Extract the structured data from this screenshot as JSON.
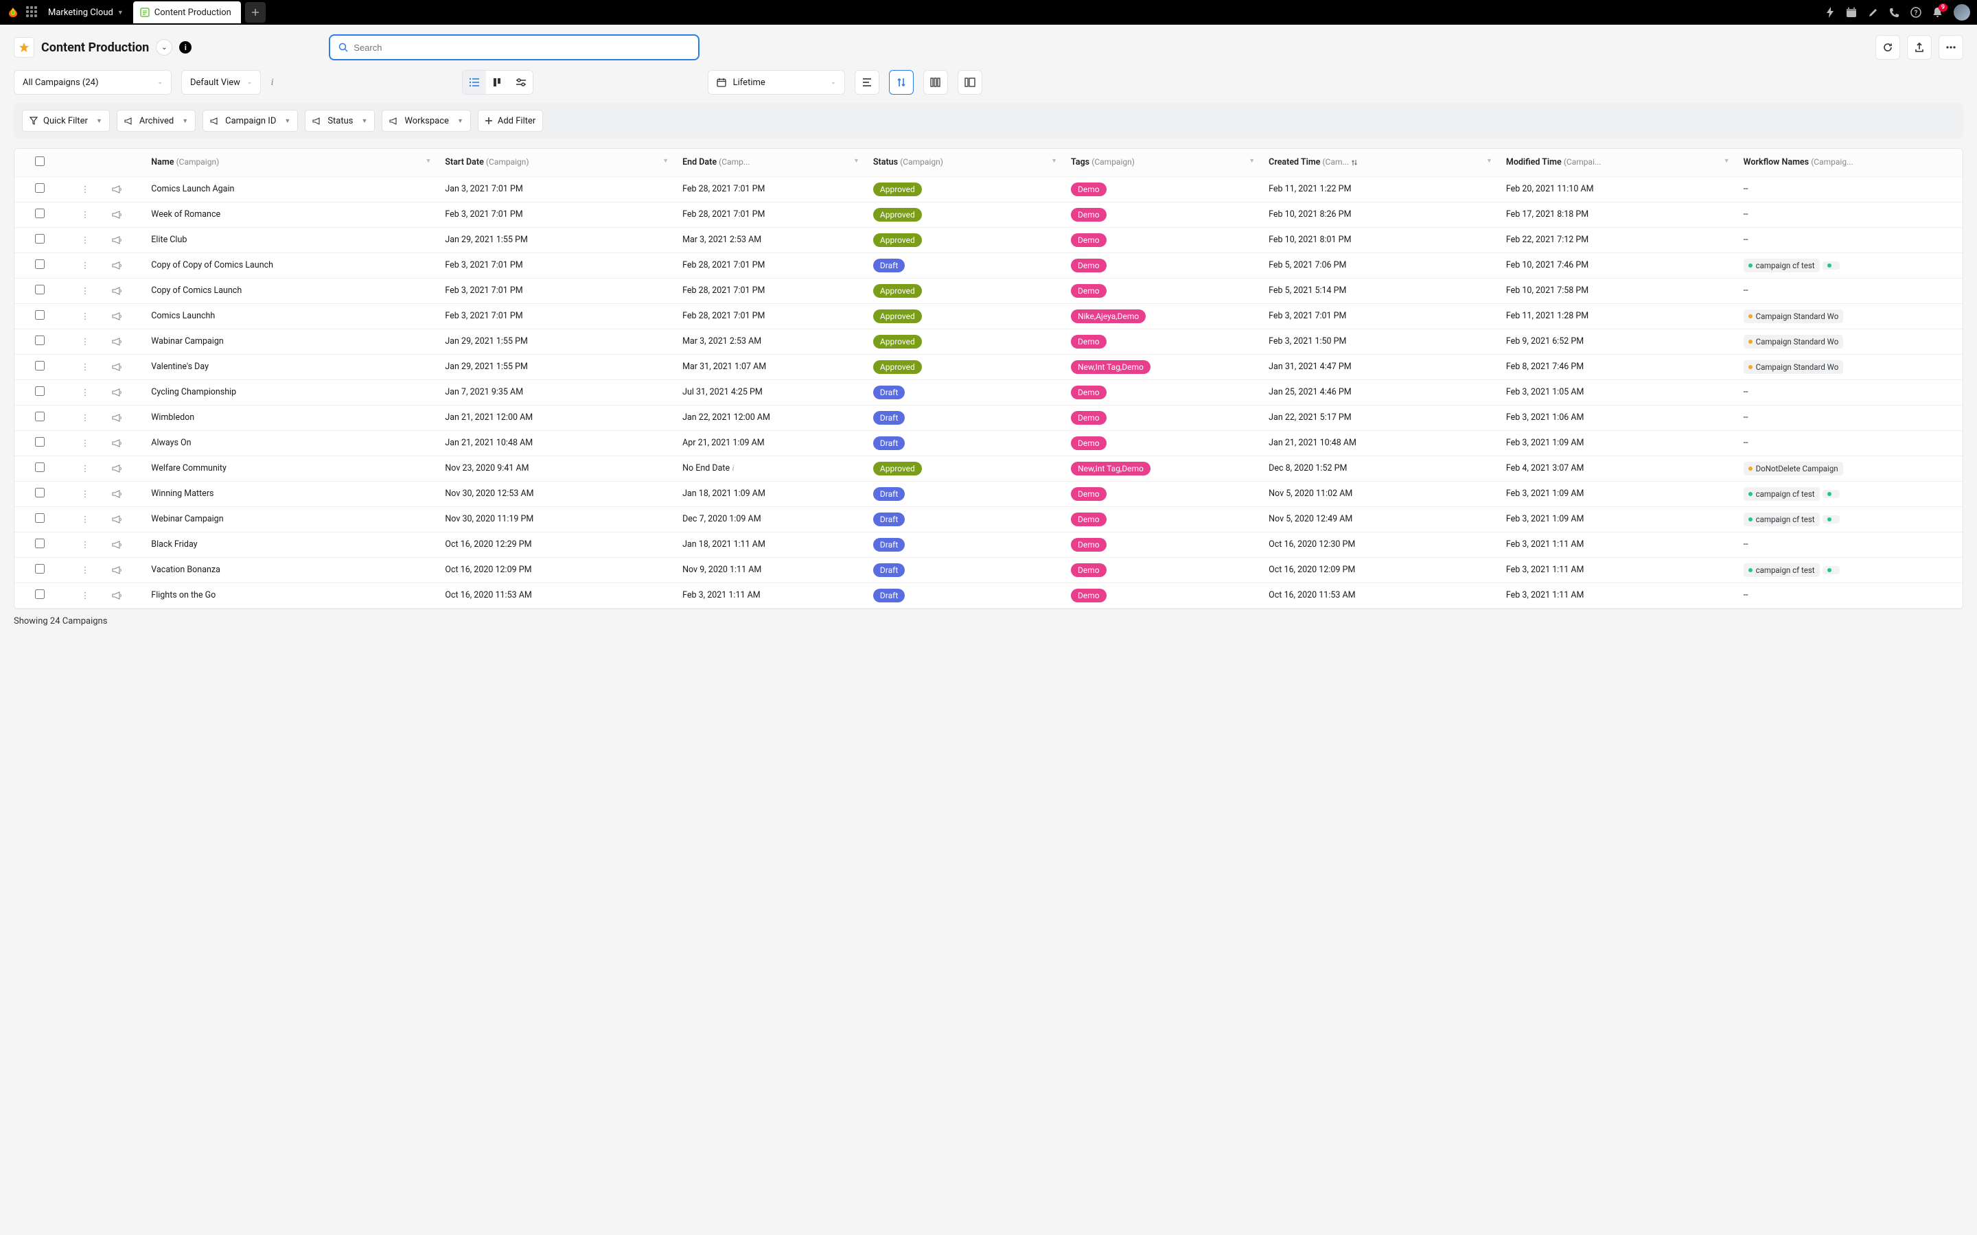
{
  "topbar": {
    "workspace_label": "Marketing Cloud",
    "active_tab_label": "Content Production",
    "notification_count": "9"
  },
  "header": {
    "page_title": "Content Production",
    "search_placeholder": "Search"
  },
  "controls": {
    "campaign_selector": "All Campaigns (24)",
    "view_selector": "Default View",
    "date_range": "Lifetime"
  },
  "filters": {
    "quick_filter": "Quick Filter",
    "archived": "Archived",
    "campaign_id": "Campaign ID",
    "status": "Status",
    "workspace": "Workspace",
    "add_filter": "Add Filter"
  },
  "table": {
    "subtext_campaign": "(Campaign)",
    "subtext_camp_trunc": "(Camp...",
    "subtext_cam_trunc": "(Cam...",
    "subtext_campai_trunc": "(Campai...",
    "subtext_campaig_trunc": "(Campaig...",
    "headers": {
      "name": "Name",
      "start_date": "Start Date",
      "end_date": "End Date",
      "status": "Status",
      "tags": "Tags",
      "created_time": "Created Time",
      "modified_time": "Modified Time",
      "workflow_names": "Workflow Names"
    },
    "rows": [
      {
        "name": "Comics Launch Again",
        "start": "Jan 3, 2021 7:01 PM",
        "end": "Feb 28, 2021 7:01 PM",
        "status": "Approved",
        "tags": "Demo",
        "created": "Feb 11, 2021 1:22 PM",
        "modified": "Feb 20, 2021 11:10 AM",
        "workflows": []
      },
      {
        "name": "Week of Romance",
        "start": "Feb 3, 2021 7:01 PM",
        "end": "Feb 28, 2021 7:01 PM",
        "status": "Approved",
        "tags": "Demo",
        "created": "Feb 10, 2021 8:26 PM",
        "modified": "Feb 17, 2021 8:18 PM",
        "workflows": []
      },
      {
        "name": "Elite Club",
        "start": "Jan 29, 2021 1:55 PM",
        "end": "Mar 3, 2021 2:53 AM",
        "status": "Approved",
        "tags": "Demo",
        "created": "Feb 10, 2021 8:01 PM",
        "modified": "Feb 22, 2021 7:12 PM",
        "workflows": []
      },
      {
        "name": "Copy of Copy of Comics Launch",
        "start": "Feb 3, 2021 7:01 PM",
        "end": "Feb 28, 2021 7:01 PM",
        "status": "Draft",
        "tags": "Demo",
        "created": "Feb 5, 2021 7:06 PM",
        "modified": "Feb 10, 2021 7:46 PM",
        "workflows": [
          {
            "dot": "green",
            "label": "campaign cf test"
          },
          {
            "dot": "green",
            "label": ""
          }
        ]
      },
      {
        "name": "Copy of Comics Launch",
        "start": "Feb 3, 2021 7:01 PM",
        "end": "Feb 28, 2021 7:01 PM",
        "status": "Approved",
        "tags": "Demo",
        "created": "Feb 5, 2021 5:14 PM",
        "modified": "Feb 10, 2021 7:58 PM",
        "workflows": []
      },
      {
        "name": "Comics Launchh",
        "start": "Feb 3, 2021 7:01 PM",
        "end": "Feb 28, 2021 7:01 PM",
        "status": "Approved",
        "tags": "Nike,Ajeya,Demo",
        "created": "Feb 3, 2021 7:01 PM",
        "modified": "Feb 11, 2021 1:28 PM",
        "workflows": [
          {
            "dot": "orange",
            "label": "Campaign Standard Wo"
          }
        ]
      },
      {
        "name": "Wabinar Campaign",
        "start": "Jan 29, 2021 1:55 PM",
        "end": "Mar 3, 2021 2:53 AM",
        "status": "Approved",
        "tags": "Demo",
        "created": "Feb 3, 2021 1:50 PM",
        "modified": "Feb 9, 2021 6:52 PM",
        "workflows": [
          {
            "dot": "orange",
            "label": "Campaign Standard Wo"
          }
        ]
      },
      {
        "name": "Valentine's Day",
        "start": "Jan 29, 2021 1:55 PM",
        "end": "Mar 31, 2021 1:07 AM",
        "status": "Approved",
        "tags": "New,Int Tag,Demo",
        "created": "Jan 31, 2021 4:47 PM",
        "modified": "Feb 8, 2021 7:46 PM",
        "workflows": [
          {
            "dot": "orange",
            "label": "Campaign Standard Wo"
          }
        ]
      },
      {
        "name": "Cycling Championship",
        "start": "Jan 7, 2021 9:35 AM",
        "end": "Jul 31, 2021 4:25 PM",
        "status": "Draft",
        "tags": "Demo",
        "created": "Jan 25, 2021 4:46 PM",
        "modified": "Feb 3, 2021 1:05 AM",
        "workflows": []
      },
      {
        "name": "Wimbledon",
        "start": "Jan 21, 2021 12:00 AM",
        "end": "Jan 22, 2021 12:00 AM",
        "status": "Draft",
        "tags": "Demo",
        "created": "Jan 22, 2021 5:17 PM",
        "modified": "Feb 3, 2021 1:06 AM",
        "workflows": []
      },
      {
        "name": "Always On",
        "start": "Jan 21, 2021 10:48 AM",
        "end": "Apr 21, 2021 1:09 AM",
        "status": "Draft",
        "tags": "Demo",
        "created": "Jan 21, 2021 10:48 AM",
        "modified": "Feb 3, 2021 1:09 AM",
        "workflows": []
      },
      {
        "name": "Welfare Community",
        "start": "Nov 23, 2020 9:41 AM",
        "end": "No End Date",
        "status": "Approved",
        "tags": "New,Int Tag,Demo",
        "created": "Dec 8, 2020 1:52 PM",
        "modified": "Feb 4, 2021 3:07 AM",
        "workflows": [
          {
            "dot": "orange",
            "label": "DoNotDelete Campaign"
          }
        ],
        "end_info": true
      },
      {
        "name": "Winning Matters",
        "start": "Nov 30, 2020 12:53 AM",
        "end": "Jan 18, 2021 1:09 AM",
        "status": "Draft",
        "tags": "Demo",
        "created": "Nov 5, 2020 11:02 AM",
        "modified": "Feb 3, 2021 1:09 AM",
        "workflows": [
          {
            "dot": "green",
            "label": "campaign cf test"
          },
          {
            "dot": "green",
            "label": ""
          }
        ]
      },
      {
        "name": "Webinar Campaign",
        "start": "Nov 30, 2020 11:19 PM",
        "end": "Dec 7, 2020 1:09 AM",
        "status": "Draft",
        "tags": "Demo",
        "created": "Nov 5, 2020 12:49 AM",
        "modified": "Feb 3, 2021 1:09 AM",
        "workflows": [
          {
            "dot": "green",
            "label": "campaign cf test"
          },
          {
            "dot": "green",
            "label": ""
          }
        ]
      },
      {
        "name": "Black Friday",
        "start": "Oct 16, 2020 12:29 PM",
        "end": "Jan 18, 2021 1:11 AM",
        "status": "Draft",
        "tags": "Demo",
        "created": "Oct 16, 2020 12:30 PM",
        "modified": "Feb 3, 2021 1:11 AM",
        "workflows": []
      },
      {
        "name": "Vacation Bonanza",
        "start": "Oct 16, 2020 12:09 PM",
        "end": "Nov 9, 2020 1:11 AM",
        "status": "Draft",
        "tags": "Demo",
        "created": "Oct 16, 2020 12:09 PM",
        "modified": "Feb 3, 2021 1:11 AM",
        "workflows": [
          {
            "dot": "green",
            "label": "campaign cf test"
          },
          {
            "dot": "green",
            "label": ""
          }
        ]
      },
      {
        "name": "Flights on the Go",
        "start": "Oct 16, 2020 11:53 AM",
        "end": "Feb 3, 2021 1:11 AM",
        "status": "Draft",
        "tags": "Demo",
        "created": "Oct 16, 2020 11:53 AM",
        "modified": "Feb 3, 2021 1:11 AM",
        "workflows": []
      }
    ]
  },
  "footer": {
    "text": "Showing 24 Campaigns"
  },
  "misc": {
    "dash": "--"
  }
}
